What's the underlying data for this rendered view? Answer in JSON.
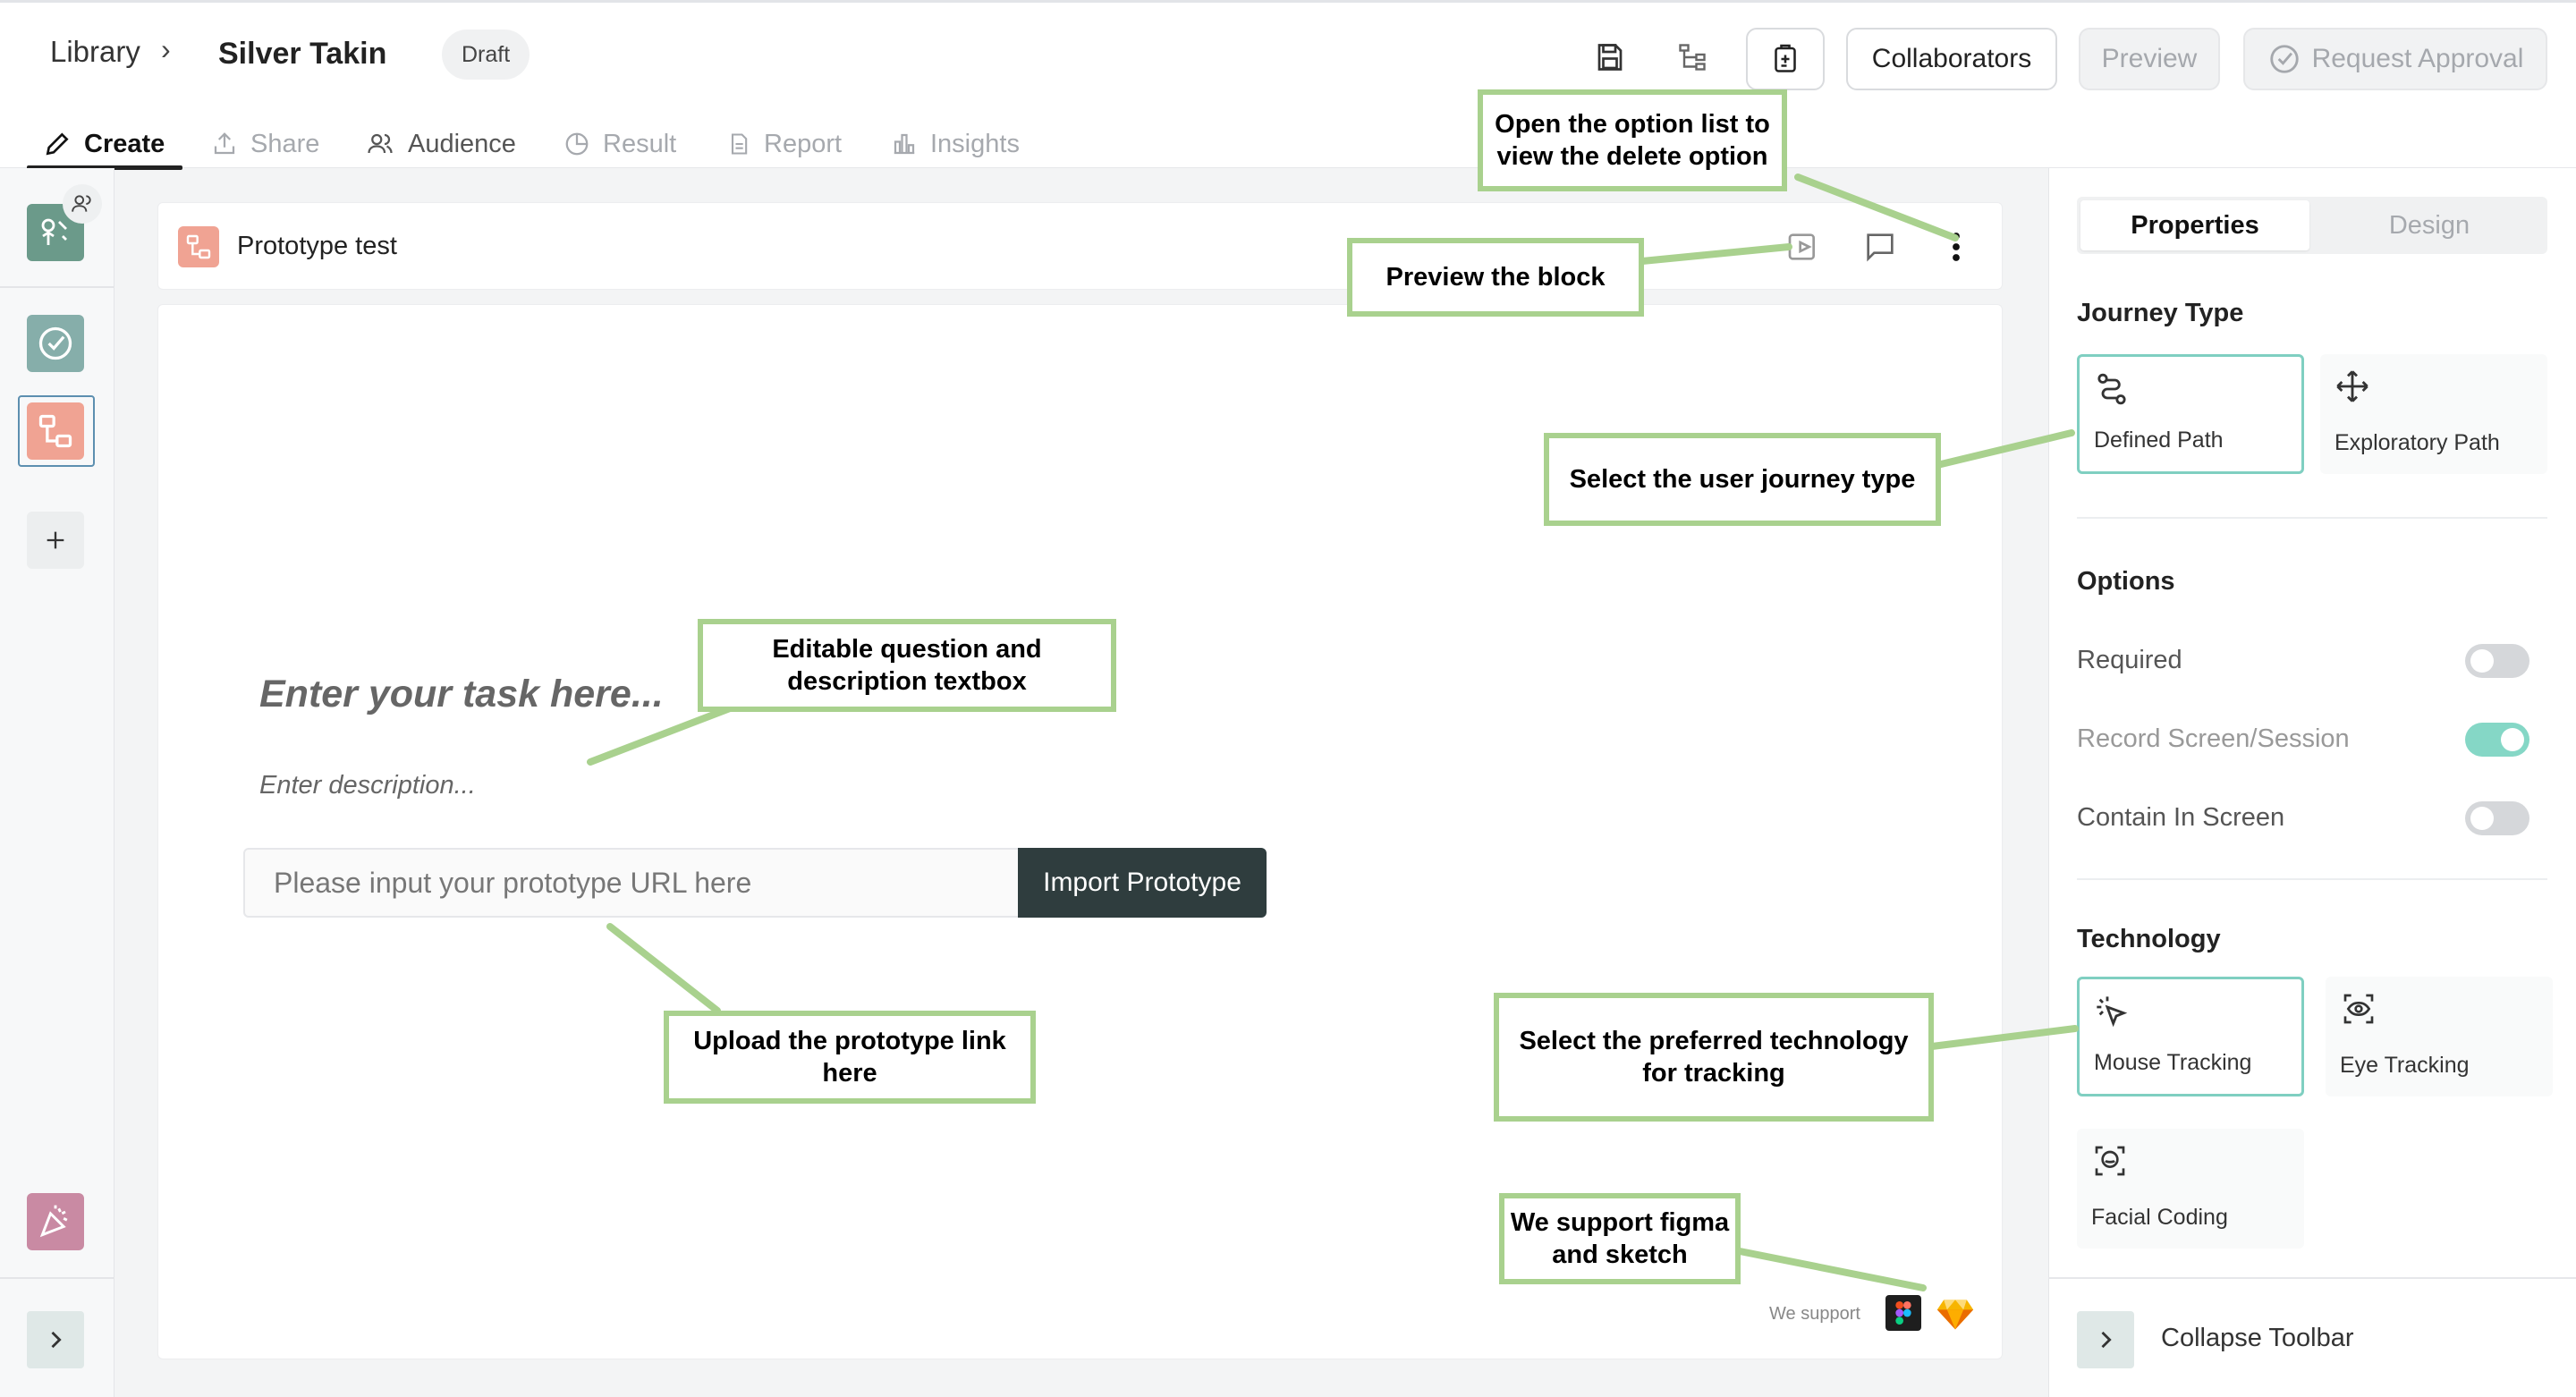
{
  "header": {
    "breadcrumb_root": "Library",
    "breadcrumb_sep": "›",
    "title": "Silver Takin",
    "status": "Draft",
    "collaborators_label": "Collaborators",
    "preview_label": "Preview",
    "request_approval_label": "Request Approval"
  },
  "tabs": [
    {
      "label": "Create",
      "icon": "pencil-icon",
      "active": true
    },
    {
      "label": "Share",
      "icon": "share-icon",
      "active": false
    },
    {
      "label": "Audience",
      "icon": "users-icon",
      "active": true
    },
    {
      "label": "Result",
      "icon": "pie-icon",
      "active": false
    },
    {
      "label": "Report",
      "icon": "document-icon",
      "active": false
    },
    {
      "label": "Insights",
      "icon": "bar-chart-icon",
      "active": false
    }
  ],
  "block": {
    "title": "Prototype test",
    "task_placeholder": "Enter your task here...",
    "description_placeholder": "Enter description...",
    "url_placeholder": "Please input your prototype URL here",
    "import_label": "Import Prototype",
    "support_label": "We support"
  },
  "panel": {
    "tabs": [
      "Properties",
      "Design"
    ],
    "journey_title": "Journey Type",
    "journey": [
      {
        "label": "Defined Path",
        "selected": true
      },
      {
        "label": "Exploratory Path",
        "selected": false
      }
    ],
    "options_title": "Options",
    "options": [
      {
        "label": "Required",
        "on": false
      },
      {
        "label": "Record Screen/Session",
        "on": true
      },
      {
        "label": "Contain In Screen",
        "on": false
      }
    ],
    "technology_title": "Technology",
    "technology": [
      {
        "label": "Mouse Tracking",
        "selected": true
      },
      {
        "label": "Eye Tracking",
        "selected": false
      },
      {
        "label": "Facial Coding",
        "selected": false
      }
    ],
    "collapse_label": "Collapse Toolbar"
  },
  "annotations": {
    "delete_option": "Open the option list to view the delete option",
    "preview_block": "Preview the block",
    "journey_type": "Select the user journey type",
    "question_box": "Editable question and description textbox",
    "upload_link": "Upload the prototype link here",
    "technology": "Select the preferred technology for tracking",
    "support": "We support figma and sketch"
  },
  "colors": {
    "accent": "#7fcfc1",
    "dark_button": "#2f3d3e",
    "annotation_border": "#a9d18e",
    "block_icon": "#f0a393"
  }
}
